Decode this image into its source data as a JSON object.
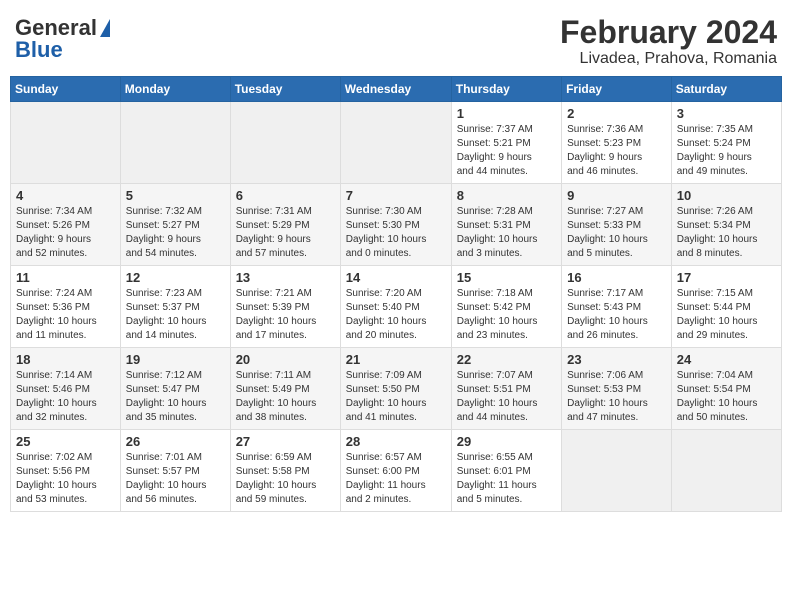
{
  "header": {
    "logo_general": "General",
    "logo_blue": "Blue",
    "month_year": "February 2024",
    "location": "Livadea, Prahova, Romania"
  },
  "weekdays": [
    "Sunday",
    "Monday",
    "Tuesday",
    "Wednesday",
    "Thursday",
    "Friday",
    "Saturday"
  ],
  "weeks": [
    [
      {
        "day": "",
        "info": ""
      },
      {
        "day": "",
        "info": ""
      },
      {
        "day": "",
        "info": ""
      },
      {
        "day": "",
        "info": ""
      },
      {
        "day": "1",
        "info": "Sunrise: 7:37 AM\nSunset: 5:21 PM\nDaylight: 9 hours\nand 44 minutes."
      },
      {
        "day": "2",
        "info": "Sunrise: 7:36 AM\nSunset: 5:23 PM\nDaylight: 9 hours\nand 46 minutes."
      },
      {
        "day": "3",
        "info": "Sunrise: 7:35 AM\nSunset: 5:24 PM\nDaylight: 9 hours\nand 49 minutes."
      }
    ],
    [
      {
        "day": "4",
        "info": "Sunrise: 7:34 AM\nSunset: 5:26 PM\nDaylight: 9 hours\nand 52 minutes."
      },
      {
        "day": "5",
        "info": "Sunrise: 7:32 AM\nSunset: 5:27 PM\nDaylight: 9 hours\nand 54 minutes."
      },
      {
        "day": "6",
        "info": "Sunrise: 7:31 AM\nSunset: 5:29 PM\nDaylight: 9 hours\nand 57 minutes."
      },
      {
        "day": "7",
        "info": "Sunrise: 7:30 AM\nSunset: 5:30 PM\nDaylight: 10 hours\nand 0 minutes."
      },
      {
        "day": "8",
        "info": "Sunrise: 7:28 AM\nSunset: 5:31 PM\nDaylight: 10 hours\nand 3 minutes."
      },
      {
        "day": "9",
        "info": "Sunrise: 7:27 AM\nSunset: 5:33 PM\nDaylight: 10 hours\nand 5 minutes."
      },
      {
        "day": "10",
        "info": "Sunrise: 7:26 AM\nSunset: 5:34 PM\nDaylight: 10 hours\nand 8 minutes."
      }
    ],
    [
      {
        "day": "11",
        "info": "Sunrise: 7:24 AM\nSunset: 5:36 PM\nDaylight: 10 hours\nand 11 minutes."
      },
      {
        "day": "12",
        "info": "Sunrise: 7:23 AM\nSunset: 5:37 PM\nDaylight: 10 hours\nand 14 minutes."
      },
      {
        "day": "13",
        "info": "Sunrise: 7:21 AM\nSunset: 5:39 PM\nDaylight: 10 hours\nand 17 minutes."
      },
      {
        "day": "14",
        "info": "Sunrise: 7:20 AM\nSunset: 5:40 PM\nDaylight: 10 hours\nand 20 minutes."
      },
      {
        "day": "15",
        "info": "Sunrise: 7:18 AM\nSunset: 5:42 PM\nDaylight: 10 hours\nand 23 minutes."
      },
      {
        "day": "16",
        "info": "Sunrise: 7:17 AM\nSunset: 5:43 PM\nDaylight: 10 hours\nand 26 minutes."
      },
      {
        "day": "17",
        "info": "Sunrise: 7:15 AM\nSunset: 5:44 PM\nDaylight: 10 hours\nand 29 minutes."
      }
    ],
    [
      {
        "day": "18",
        "info": "Sunrise: 7:14 AM\nSunset: 5:46 PM\nDaylight: 10 hours\nand 32 minutes."
      },
      {
        "day": "19",
        "info": "Sunrise: 7:12 AM\nSunset: 5:47 PM\nDaylight: 10 hours\nand 35 minutes."
      },
      {
        "day": "20",
        "info": "Sunrise: 7:11 AM\nSunset: 5:49 PM\nDaylight: 10 hours\nand 38 minutes."
      },
      {
        "day": "21",
        "info": "Sunrise: 7:09 AM\nSunset: 5:50 PM\nDaylight: 10 hours\nand 41 minutes."
      },
      {
        "day": "22",
        "info": "Sunrise: 7:07 AM\nSunset: 5:51 PM\nDaylight: 10 hours\nand 44 minutes."
      },
      {
        "day": "23",
        "info": "Sunrise: 7:06 AM\nSunset: 5:53 PM\nDaylight: 10 hours\nand 47 minutes."
      },
      {
        "day": "24",
        "info": "Sunrise: 7:04 AM\nSunset: 5:54 PM\nDaylight: 10 hours\nand 50 minutes."
      }
    ],
    [
      {
        "day": "25",
        "info": "Sunrise: 7:02 AM\nSunset: 5:56 PM\nDaylight: 10 hours\nand 53 minutes."
      },
      {
        "day": "26",
        "info": "Sunrise: 7:01 AM\nSunset: 5:57 PM\nDaylight: 10 hours\nand 56 minutes."
      },
      {
        "day": "27",
        "info": "Sunrise: 6:59 AM\nSunset: 5:58 PM\nDaylight: 10 hours\nand 59 minutes."
      },
      {
        "day": "28",
        "info": "Sunrise: 6:57 AM\nSunset: 6:00 PM\nDaylight: 11 hours\nand 2 minutes."
      },
      {
        "day": "29",
        "info": "Sunrise: 6:55 AM\nSunset: 6:01 PM\nDaylight: 11 hours\nand 5 minutes."
      },
      {
        "day": "",
        "info": ""
      },
      {
        "day": "",
        "info": ""
      }
    ]
  ]
}
